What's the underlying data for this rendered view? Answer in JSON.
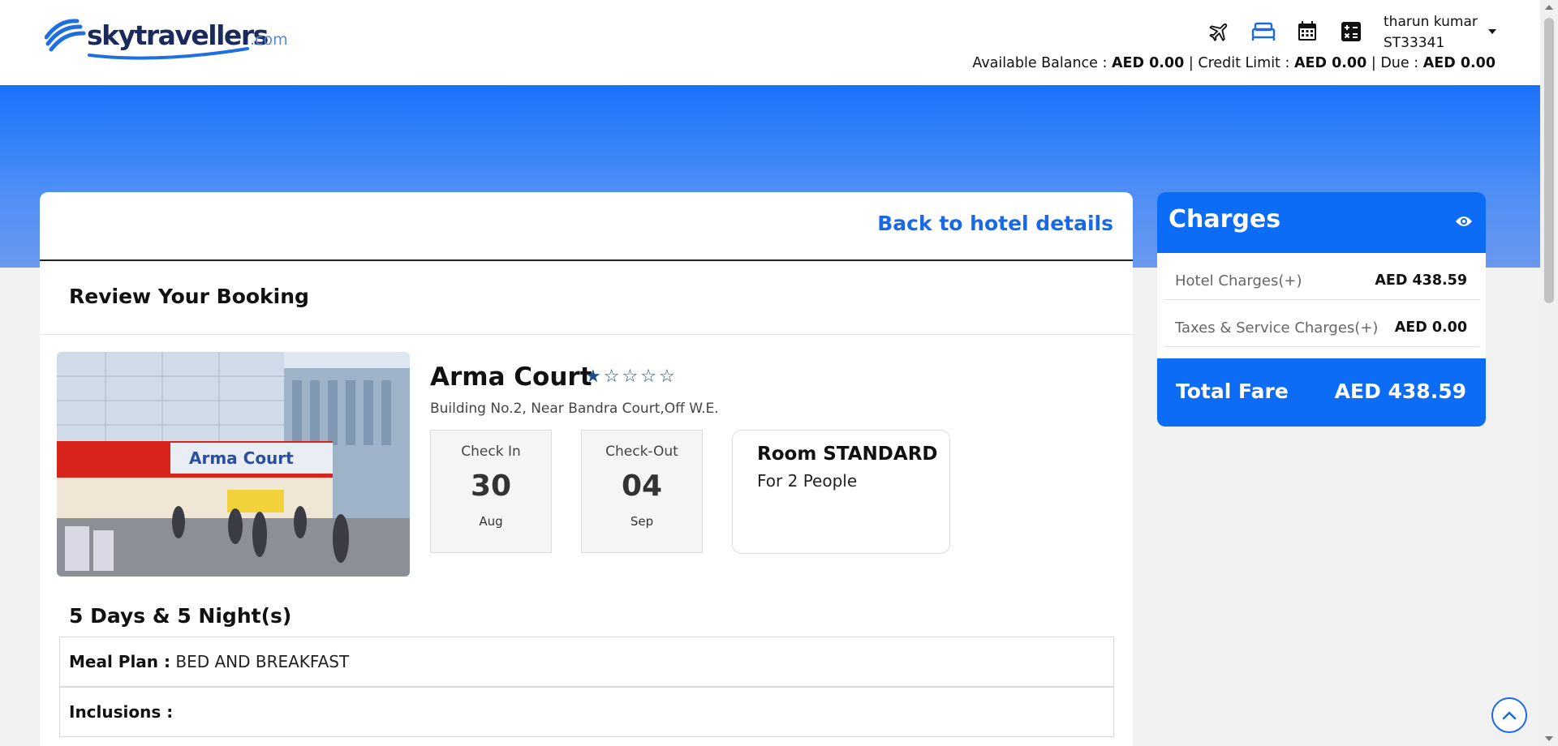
{
  "brand": {
    "name": "skytravellers",
    "tld": ".com"
  },
  "header": {
    "user_name": "tharun kumar",
    "user_id": "ST33341",
    "balance_label": "Available Balance :",
    "balance_value": "AED 0.00",
    "credit_label": "Credit Limit :",
    "credit_value": "AED 0.00",
    "due_label": "Due :",
    "due_value": "AED 0.00",
    "sep": "|"
  },
  "nav_icons": [
    "flight-icon",
    "hotel-icon",
    "calendar-icon",
    "calculator-icon"
  ],
  "booking": {
    "back_link": "Back to hotel details",
    "review_title": "Review Your Booking",
    "hotel_name": "Arma Court",
    "stars_filled": 1,
    "stars_total": 5,
    "address": "Building No.2, Near Bandra Court,Off W.E.",
    "photo_sign": "Arma Court",
    "check_in": {
      "label": "Check In",
      "day": "30",
      "month": "Aug"
    },
    "check_out": {
      "label": "Check-Out",
      "day": "04",
      "month": "Sep"
    },
    "room_title": "Room STANDARD",
    "room_people": "For 2 People",
    "duration": "5 Days & 5 Night(s)",
    "meal_label": "Meal Plan :",
    "meal_value": "BED AND BREAKFAST",
    "inclusions_label": "Inclusions :"
  },
  "charges": {
    "title": "Charges",
    "hotel_label": "Hotel Charges(+)",
    "hotel_value": "AED 438.59",
    "tax_label": "Taxes & Service Charges(+)",
    "tax_value": "AED 0.00",
    "total_label": "Total Fare",
    "total_value": "AED 438.59"
  },
  "colors": {
    "primary": "#0c6cf5",
    "link": "#1769e8",
    "star": "#1a4e8c"
  }
}
